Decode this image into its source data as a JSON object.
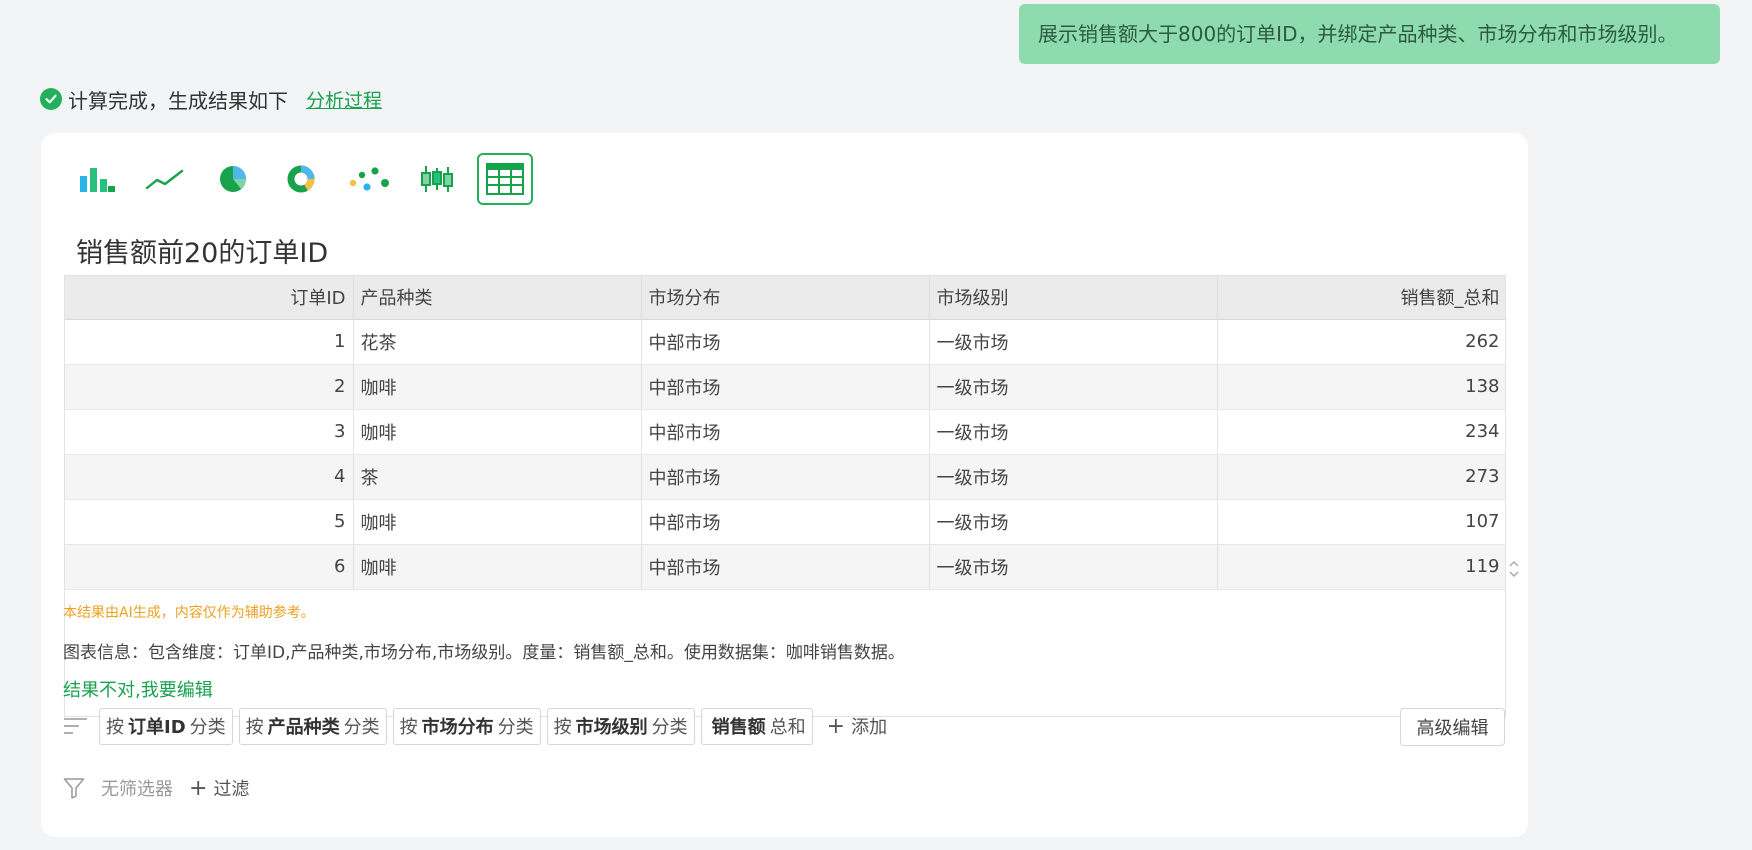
{
  "user_message": "展示销售额大于800的订单ID，并绑定产品种类、市场分布和市场级别。",
  "status": {
    "text": "计算完成，生成结果如下",
    "link": "分析过程"
  },
  "chart_types": [
    "bar-chart-icon",
    "line-chart-icon",
    "pie-chart-icon",
    "donut-chart-icon",
    "scatter-chart-icon",
    "boxplot-chart-icon",
    "table-icon"
  ],
  "table": {
    "title": "销售额前20的订单ID",
    "headers": [
      "订单ID",
      "产品种类",
      "市场分布",
      "市场级别",
      "销售额_总和"
    ],
    "rows": [
      [
        "1",
        "花茶",
        "中部市场",
        "一级市场",
        "262"
      ],
      [
        "2",
        "咖啡",
        "中部市场",
        "一级市场",
        "138"
      ],
      [
        "3",
        "咖啡",
        "中部市场",
        "一级市场",
        "234"
      ],
      [
        "4",
        "茶",
        "中部市场",
        "一级市场",
        "273"
      ],
      [
        "5",
        "咖啡",
        "中部市场",
        "一级市场",
        "107"
      ],
      [
        "6",
        "咖啡",
        "中部市场",
        "一级市场",
        "119"
      ]
    ]
  },
  "disclaimer": "本结果由AI生成，内容仅作为辅助参考。",
  "chart_info": "图表信息：包含维度：订单ID,产品种类,市场分布,市场级别。度量：销售额_总和。使用数据集：咖啡销售数据。",
  "edit_link": "结果不对,我要编辑",
  "dimension_tags": [
    {
      "prefix": "按",
      "bold": "订单ID",
      "suffix": "分类"
    },
    {
      "prefix": "按",
      "bold": "产品种类",
      "suffix": "分类"
    },
    {
      "prefix": "按",
      "bold": "市场分布",
      "suffix": "分类"
    },
    {
      "prefix": "按",
      "bold": "市场级别",
      "suffix": "分类"
    }
  ],
  "measure_tag": {
    "bold": "销售额",
    "suffix": "总和"
  },
  "add_label": "添加",
  "advanced_edit": "高级编辑",
  "filter": {
    "placeholder": "无筛选器",
    "add_label": "过滤"
  },
  "colors": {
    "accent": "#22b15a",
    "bubble": "#8fdbb0",
    "warning": "#f0a020"
  }
}
